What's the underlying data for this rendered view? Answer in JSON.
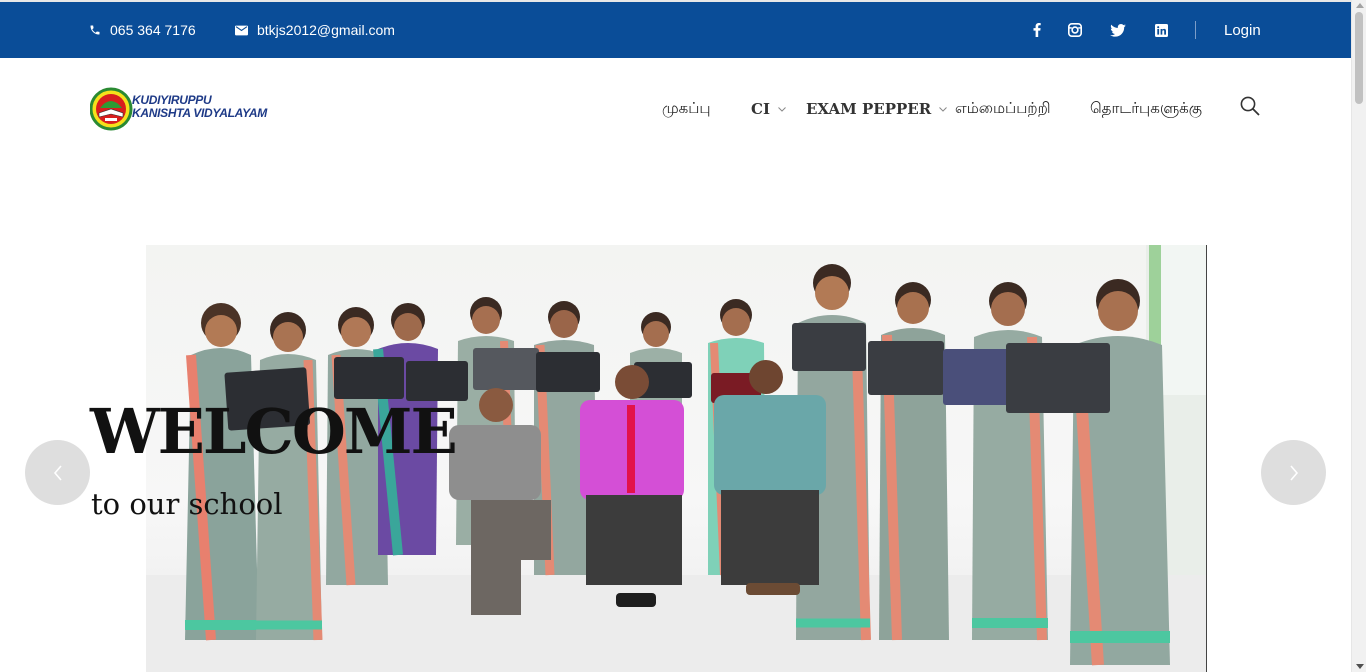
{
  "topbar": {
    "phone": "065 364 7176",
    "email": "btkjs2012@gmail.com",
    "social_icons": [
      "facebook-icon",
      "instagram-icon",
      "twitter-icon",
      "linkedin-icon"
    ],
    "login_label": "Login",
    "background_color": "#0a4d98"
  },
  "logo": {
    "line1": "KUDIYIRUPPU",
    "line2": "KANISHTA VIDYALAYAM",
    "text_color": "#1e3a87"
  },
  "nav": {
    "items": [
      {
        "label": "முகப்பு",
        "has_dropdown": false
      },
      {
        "label": "CI",
        "has_dropdown": true
      },
      {
        "label": "EXAM PEPPER",
        "has_dropdown": true
      },
      {
        "label": "எம்மைப்பற்றி",
        "has_dropdown": false
      },
      {
        "label": "தொடர்புகளுக்கு",
        "has_dropdown": false
      }
    ],
    "search_icon": "search-icon"
  },
  "hero": {
    "title": "WELCOME",
    "subtitle": "to our school",
    "image_subject": "group photo of school staff holding laptops",
    "prev_icon": "chevron-left-icon",
    "next_icon": "chevron-right-icon"
  }
}
